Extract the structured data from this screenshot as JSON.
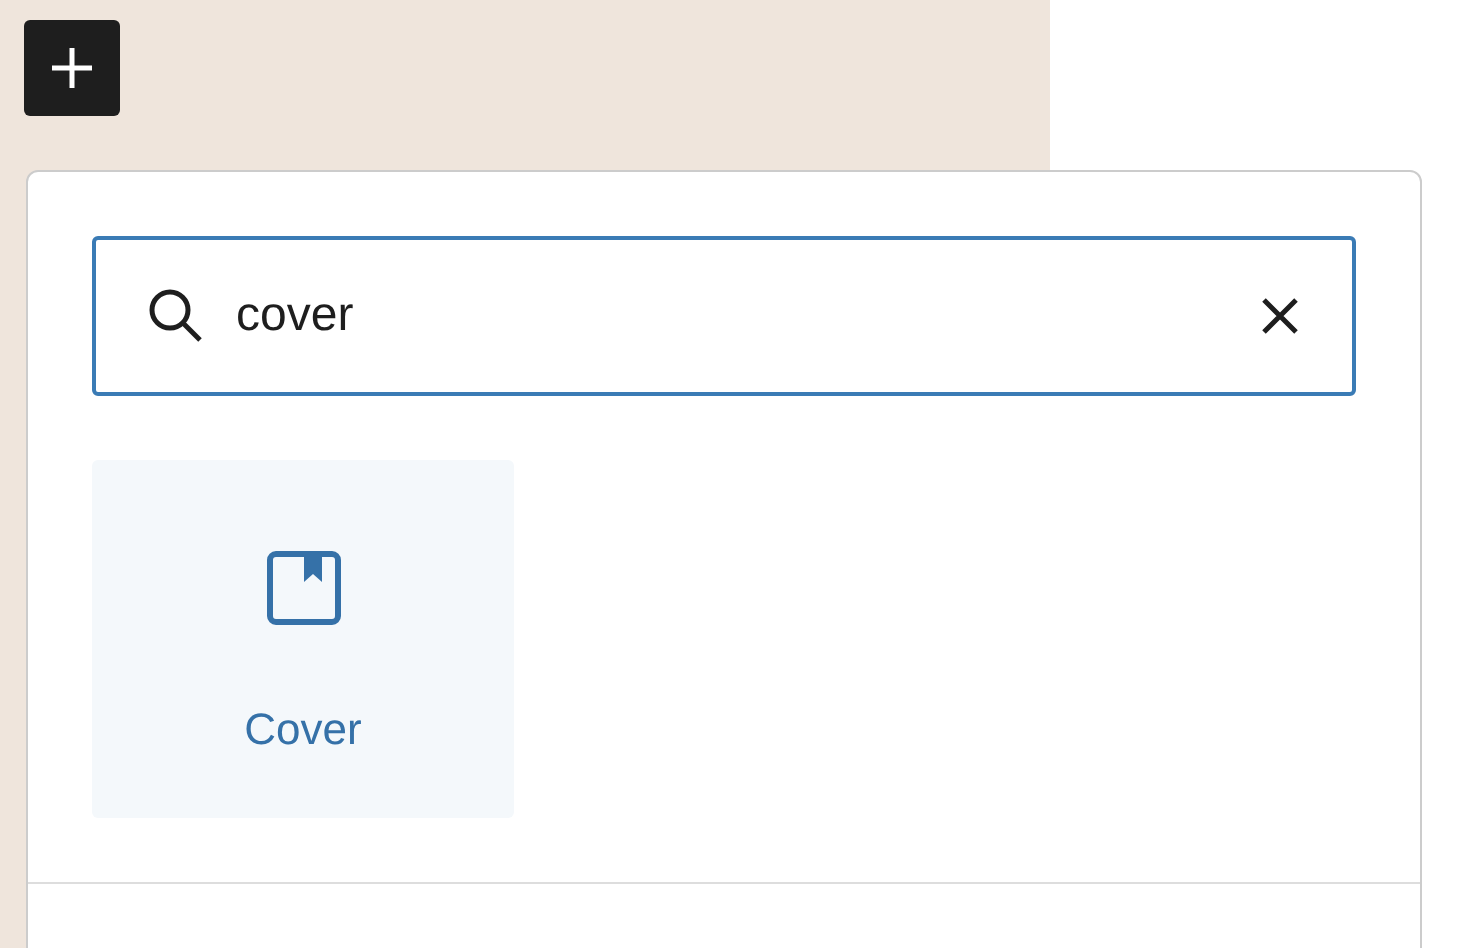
{
  "search": {
    "value": "cover",
    "focused": true
  },
  "results": [
    {
      "label": "Cover",
      "highlighted": true
    }
  ]
}
